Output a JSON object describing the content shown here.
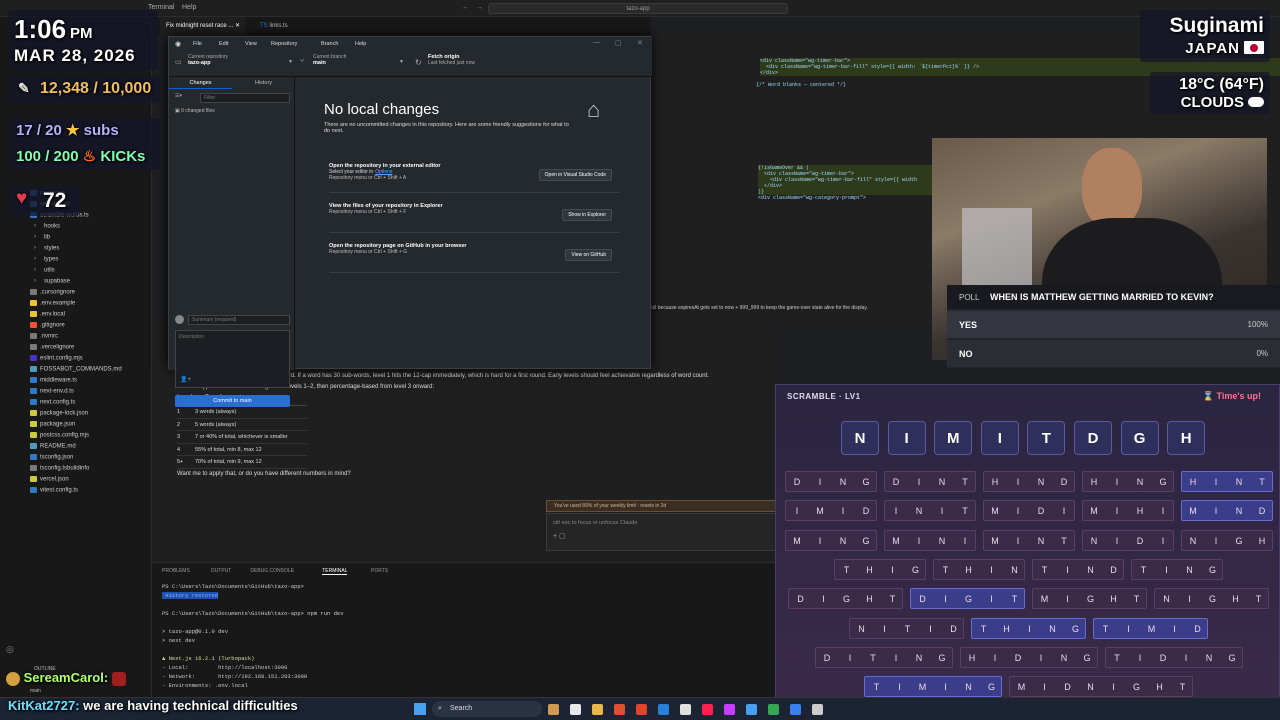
{
  "vscode": {
    "menu": [
      "Terminal",
      "Help"
    ],
    "search": "tazo-app",
    "tabs": [
      "Fix midnight reset race ...",
      "links.ts"
    ],
    "sidebar_files": [
      {
        "name": "content.ts",
        "color": "#3178c6"
      },
      {
        "name": "sessions.ts",
        "color": "#3178c6"
      },
      {
        "name": "scramble-words.ts",
        "color": "#3178c6"
      },
      {
        "name": "hooks",
        "color": "#7a7a7a"
      },
      {
        "name": "lib",
        "color": "#7a7a7a"
      },
      {
        "name": "styles",
        "color": "#7a7a7a"
      },
      {
        "name": "types",
        "color": "#7a7a7a"
      },
      {
        "name": "utils",
        "color": "#7a7a7a"
      },
      {
        "name": "supabase",
        "color": "#7a7a7a"
      },
      {
        "name": ".cursorignore",
        "color": "#7a7a7a"
      },
      {
        "name": ".env.example",
        "color": "#e8c23a"
      },
      {
        "name": ".env.local",
        "color": "#e8c23a"
      },
      {
        "name": ".gitignore",
        "color": "#f05133"
      },
      {
        "name": ".nvmrc",
        "color": "#7a7a7a"
      },
      {
        "name": ".vercelignore",
        "color": "#7a7a7a"
      },
      {
        "name": "eslint.config.mjs",
        "color": "#4b32c3"
      },
      {
        "name": "FOSSABOT_COMMANDS.md",
        "color": "#519aba"
      },
      {
        "name": "middleware.ts",
        "color": "#3178c6"
      },
      {
        "name": "next-env.d.ts",
        "color": "#3178c6"
      },
      {
        "name": "next.config.ts",
        "color": "#3178c6"
      },
      {
        "name": "package-lock.json",
        "color": "#cbcb41"
      },
      {
        "name": "package.json",
        "color": "#cbcb41"
      },
      {
        "name": "postcss.config.mjs",
        "color": "#cbcb41"
      },
      {
        "name": "README.md",
        "color": "#519aba"
      },
      {
        "name": "tsconfig.json",
        "color": "#3178c6"
      },
      {
        "name": "tsconfig.tsbuildinfo",
        "color": "#7a7a7a"
      },
      {
        "name": "vercel.json",
        "color": "#cbcb41"
      },
      {
        "name": "vitest.config.ts",
        "color": "#3178c6"
      }
    ],
    "code": [
      "<div className=\"wg-timer-bar\">",
      "  <div className=\"wg-timer-bar-fill\" style={{ width: `${timerPct}%` }} />",
      "</div>",
      "",
      "{/* Word blanks — centered */}"
    ],
    "code2": [
      "{!isGameOver && (",
      "  <div className=\"wg-timer-bar\">",
      "    <div className=\"wg-timer-bar-fill\" style={{ width",
      "  </div>",
      ")}",
      "<div className=\"wg-category-prompt\">"
    ],
    "chat_line1": "full because expiresAt gets set to now + 999_999 to keep the game-over state alive for the display.",
    "chat_answer": "Yes — the percentage scales poorly upward. If a word has 30 sub-words, level 1 hits the 12-cap immediately, which is hard for a first round. Early levels should feel achievable regardless of word count.",
    "chat_better": "A better approach: fixed small targets for levels 1–2, then percentage-based from level 3 onward:",
    "table_head": [
      "Level",
      "Requirement"
    ],
    "table_rows": [
      [
        "1",
        "3 words (always)"
      ],
      [
        "2",
        "5 words (always)"
      ],
      [
        "3",
        "7 or 40% of total, whichever is smaller"
      ],
      [
        "4",
        "55% of total, min 8, max 12"
      ],
      [
        "5+",
        "70% of total, min 9, max 12"
      ]
    ],
    "chat_question": "Want me to apply that, or do you have different numbers in mind?",
    "limit_notice": "You've used 89% of your weekly limit · resets in 2d",
    "chat_input_placeholder": "ctrl esc to focus or unfocus Claude",
    "panel_tabs": [
      "PROBLEMS",
      "OUTPUT",
      "DEBUG CONSOLE",
      "TERMINAL",
      "PORTS"
    ],
    "terminal": [
      "PS C:\\Users\\Tazo\\Documents\\GitHub\\tazo-app>",
      " History restored",
      "",
      "PS C:\\Users\\Tazo\\Documents\\GitHub\\tazo-app> npm run dev",
      "",
      "> tazo-app@0.1.0 dev",
      "> next dev",
      "",
      "▲ Next.js 16.2.1 (Turbopack)",
      "- Local:         http://localhost:3000",
      "- Network:       http://192.168.151.203:3000",
      "- Environments: .env.local"
    ],
    "outline": "OUTLINE",
    "branch": "main"
  },
  "github": {
    "menu": [
      "File",
      "Edit",
      "View",
      "Repository",
      "Branch",
      "Help"
    ],
    "current_repo_label": "Current repository",
    "current_repo": "tazo-app",
    "current_branch_label": "Current branch",
    "current_branch": "main",
    "fetch_label": "Fetch origin",
    "fetch_sub": "Last fetched just now",
    "tabs": [
      "Changes",
      "History"
    ],
    "filter_placeholder": "Filter",
    "changed_files": "0 changed files",
    "heading": "No local changes",
    "subtext": "There are no uncommitted changes in this repository. Here are some friendly suggestions for what to do next.",
    "cards": [
      {
        "title": "Open the repository in your external editor",
        "line": "Select your editor in",
        "link": "Options",
        "shortcut": "Repository menu or  Ctrl + Shift + A",
        "button": "Open in Visual Studio Code"
      },
      {
        "title": "View the files of your repository in Explorer",
        "line": "",
        "link": "",
        "shortcut": "Repository menu or  Ctrl + Shift + F",
        "button": "Show in Explorer"
      },
      {
        "title": "Open the repository page on GitHub in your browser",
        "line": "",
        "link": "",
        "shortcut": "Repository menu or  Ctrl + Shift + G",
        "button": "View on GitHub"
      }
    ],
    "summary_placeholder": "Summary (required)",
    "description_placeholder": "Description",
    "commit_button": "Commit to main"
  },
  "overlay": {
    "time": "1:06",
    "ampm": "PM",
    "date": "MAR 28, 2026",
    "bits": "12,348 / 10,000",
    "subs": "17 / 20",
    "subs_label": "subs",
    "kicks": "100 / 200",
    "kicks_label": "KICKs",
    "heart": "72",
    "city": "Suginami",
    "country": "JAPAN",
    "temp": "18°C (64°F)",
    "weather": "CLOUDS"
  },
  "poll": {
    "label": "POLL",
    "question": "WHEN IS MATTHEW GETTING MARRIED TO KEVIN?",
    "options": [
      {
        "text": "YES",
        "pct": "100%",
        "value": 100
      },
      {
        "text": "NO",
        "pct": "0%",
        "value": 0
      }
    ]
  },
  "scramble": {
    "title": "SCRAMBLE · LV1",
    "status": "Time's up!",
    "letters": [
      "N",
      "I",
      "M",
      "I",
      "T",
      "D",
      "G",
      "H"
    ],
    "rows": [
      [
        {
          "w": "DING",
          "f": false
        },
        {
          "w": "DINT",
          "f": false
        },
        {
          "w": "HIND",
          "f": false
        },
        {
          "w": "HING",
          "f": false
        },
        {
          "w": "HINT",
          "f": true
        }
      ],
      [
        {
          "w": "IMID",
          "f": false
        },
        {
          "w": "INIT",
          "f": false
        },
        {
          "w": "MIDI",
          "f": false
        },
        {
          "w": "MIHI",
          "f": false
        },
        {
          "w": "MIND",
          "f": true
        }
      ],
      [
        {
          "w": "MING",
          "f": false
        },
        {
          "w": "MINI",
          "f": false
        },
        {
          "w": "MINT",
          "f": false
        },
        {
          "w": "NIDI",
          "f": false
        },
        {
          "w": "NIGH",
          "f": false
        }
      ],
      [
        {
          "w": "THIG",
          "f": false
        },
        {
          "w": "THIN",
          "f": false
        },
        {
          "w": "TIND",
          "f": false
        },
        {
          "w": "TING",
          "f": false
        }
      ],
      [
        {
          "w": "DIGHT",
          "f": false
        },
        {
          "w": "DIGIT",
          "f": true
        },
        {
          "w": "MIGHT",
          "f": false
        },
        {
          "w": "NIGHT",
          "f": false
        }
      ],
      [
        {
          "w": "NITID",
          "f": false
        },
        {
          "w": "THING",
          "f": true
        },
        {
          "w": "TIMID",
          "f": true
        }
      ],
      [
        {
          "w": "DITING",
          "f": false
        },
        {
          "w": "HIDING",
          "f": false
        },
        {
          "w": "TIDING",
          "f": false
        }
      ],
      [
        {
          "w": "TIMING",
          "f": true
        },
        {
          "w": "MIDNIGHT",
          "f": false
        }
      ]
    ]
  },
  "chat_overlay": [
    {
      "user": "SereamCarol:",
      "msg": ""
    },
    {
      "user": "KitKat2727:",
      "msg": "we are having technical difficulties"
    }
  ],
  "taskbar": {
    "search": "Search"
  }
}
